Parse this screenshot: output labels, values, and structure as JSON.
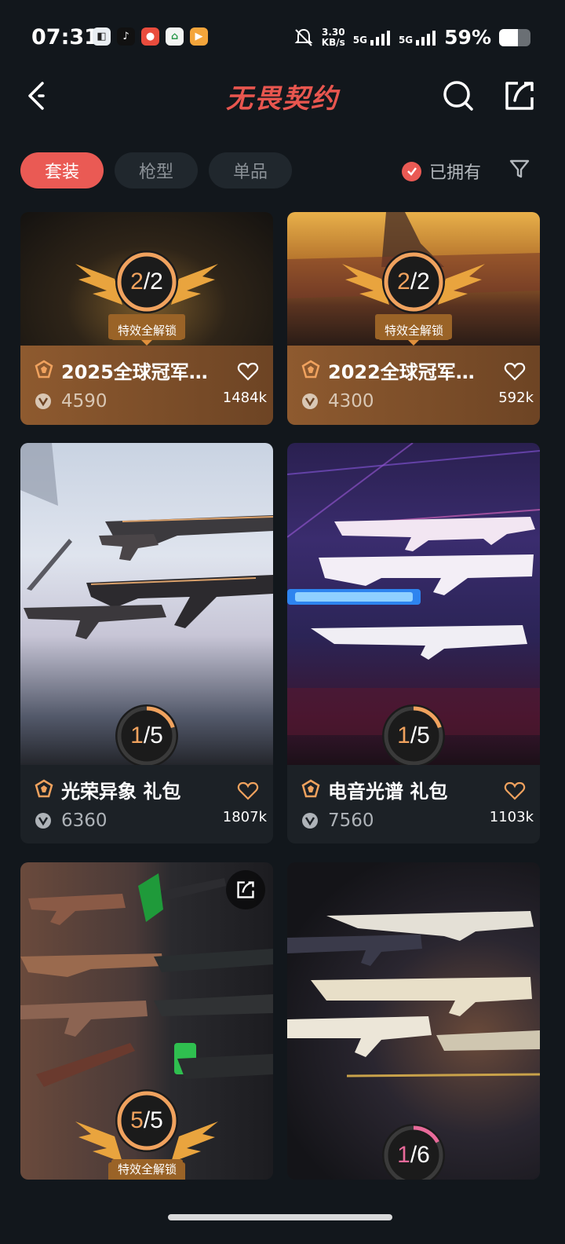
{
  "status_bar": {
    "time": "07:31",
    "net_speed_value": "3.30",
    "net_speed_unit": "KB/s",
    "signal1": "5G",
    "signal2": "5G",
    "battery": "59%",
    "battery_level": 0.59
  },
  "header": {
    "title": "无畏契约"
  },
  "tabs": [
    {
      "label": "套装",
      "active": true
    },
    {
      "label": "枪型",
      "active": false
    },
    {
      "label": "单品",
      "active": false
    }
  ],
  "filter": {
    "owned_label": "已拥有"
  },
  "cards": [
    {
      "title": "2025全球冠军…",
      "price": "4590",
      "likes": "1484k",
      "owned": "2",
      "total": "2",
      "progress": 1.0,
      "unlock_label": "特效全解锁"
    },
    {
      "title": "2022全球冠军…",
      "price": "4300",
      "likes": "592k",
      "owned": "2",
      "total": "2",
      "progress": 1.0,
      "unlock_label": "特效全解锁"
    },
    {
      "title": "光荣异象 礼包",
      "price": "6360",
      "likes": "1807k",
      "owned": "1",
      "total": "5",
      "progress": 0.2
    },
    {
      "title": "电音光谱 礼包",
      "price": "7560",
      "likes": "1103k",
      "owned": "1",
      "total": "5",
      "progress": 0.2
    },
    {
      "owned": "5",
      "total": "5",
      "progress": 1.0,
      "unlock_label": "特效全解锁"
    },
    {
      "owned": "1",
      "total": "6",
      "progress": 0.17
    }
  ],
  "colors": {
    "accent": "#ea5a54",
    "ring_progress": "#f0a25e",
    "background": "#12171c"
  }
}
